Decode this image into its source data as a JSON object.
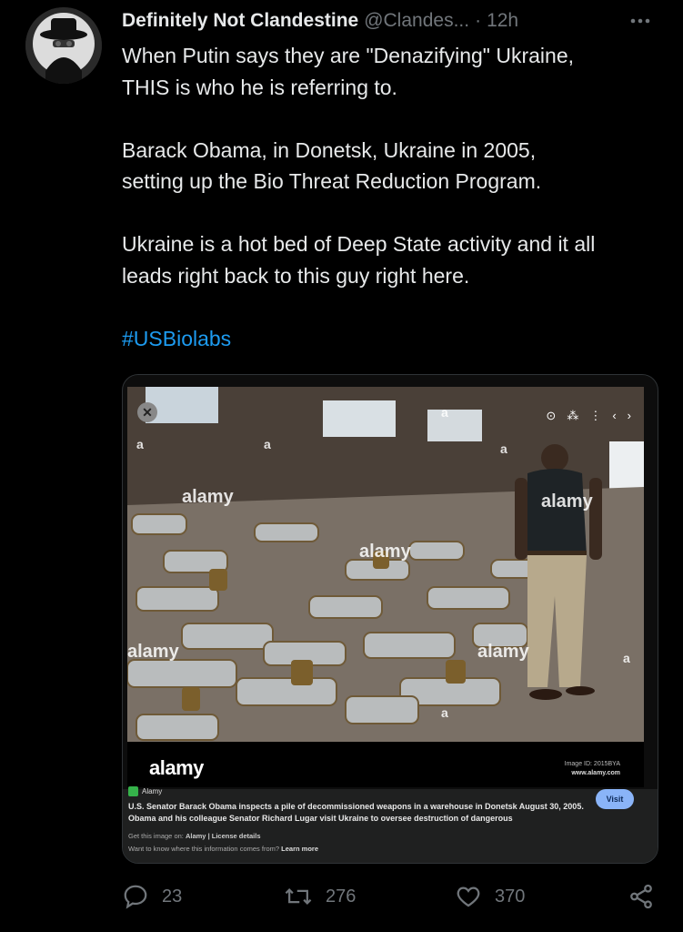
{
  "tweet": {
    "author_name": "Definitely Not Clandestine",
    "handle": "@Clandes...",
    "separator": "·",
    "time": "12h",
    "lines": [
      "When Putin says they are \"Denazifying\" Ukraine,",
      "THIS is who he is referring to.",
      "",
      "Barack Obama, in Donetsk, Ukraine in 2005,",
      "setting up the Bio Threat Reduction Program.",
      "",
      "Ukraine is a hot bed of Deep State activity and it all",
      "leads right back to this guy right here.",
      ""
    ],
    "hashtag": "#USBiolabs"
  },
  "media": {
    "alamy_logo": "alamy",
    "image_id_line1": "Image ID: 2015BYA",
    "image_id_line2": "www.alamy.com",
    "watermark": "alamy",
    "watermark_small": "a",
    "source_name": "Alamy",
    "caption": "U.S. Senator Barack Obama inspects a pile of decommissioned weapons in a warehouse in Donetsk August 30, 2005. Obama and his colleague Senator Richard Lugar visit Ukraine to oversee destruction of dangerous",
    "get_image_prefix": "Get this image on:",
    "get_image_links": "Alamy | License details",
    "info_question": "Want to know where this information comes from?",
    "info_link": "Learn more",
    "visit_label": "Visit"
  },
  "actions": {
    "replies": "23",
    "retweets": "276",
    "likes": "370"
  },
  "colors": {
    "background": "#000000",
    "text": "#e7e9ea",
    "muted": "#71767b",
    "accent": "#1d9bf0"
  }
}
